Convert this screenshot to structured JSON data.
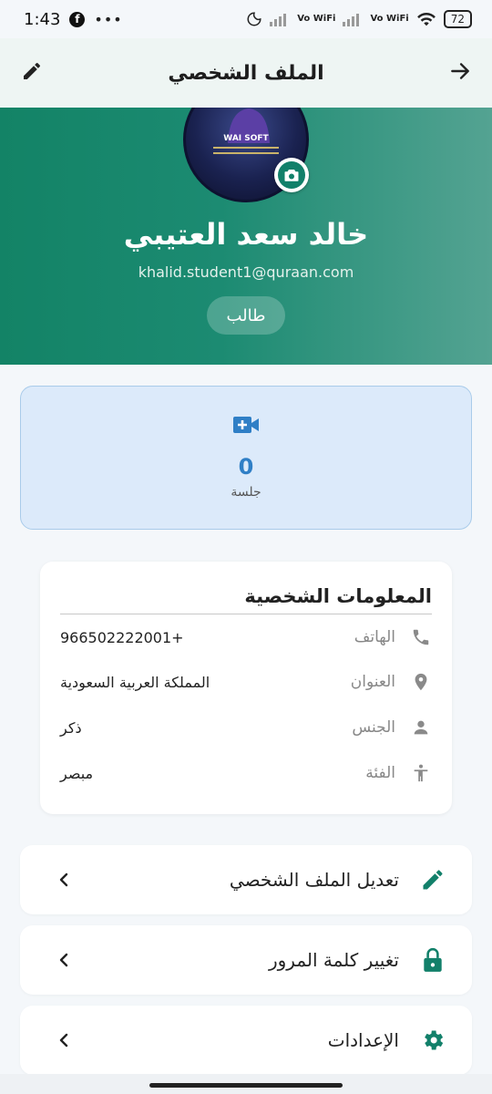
{
  "status_bar": {
    "time": "1:43",
    "more": "•••",
    "volte_1": "Vo WiFi",
    "volte_2": "Vo WiFi",
    "battery": "72"
  },
  "app_bar": {
    "title": "الملف الشخصي"
  },
  "profile": {
    "name": "خالد سعد العتيبي",
    "email": "khalid.student1@quraan.com",
    "role": "طالب",
    "avatar_brand": "WAI SOFT"
  },
  "sessions": {
    "count": "0",
    "label": "جلسة"
  },
  "personal_info": {
    "title": "المعلومات الشخصية",
    "rows": [
      {
        "label": "الهاتف",
        "value": "966502222001+",
        "icon": "phone-icon"
      },
      {
        "label": "العنوان",
        "value": "المملكة العربية السعودية",
        "icon": "location-pin-icon"
      },
      {
        "label": "الجنس",
        "value": "ذكر",
        "icon": "person-icon"
      },
      {
        "label": "الفئة",
        "value": "مبصر",
        "icon": "accessibility-icon"
      }
    ]
  },
  "menu": [
    {
      "label": "تعديل الملف الشخصي",
      "icon": "pencil-icon"
    },
    {
      "label": "تغيير كلمة المرور",
      "icon": "lock-icon"
    },
    {
      "label": "الإعدادات",
      "icon": "gear-icon"
    }
  ],
  "colors": {
    "primary": "#12806a",
    "header_start": "#138366",
    "header_end": "#54a392",
    "sessions_bg": "#dceafa",
    "sessions_accent": "#2f7fc6"
  }
}
